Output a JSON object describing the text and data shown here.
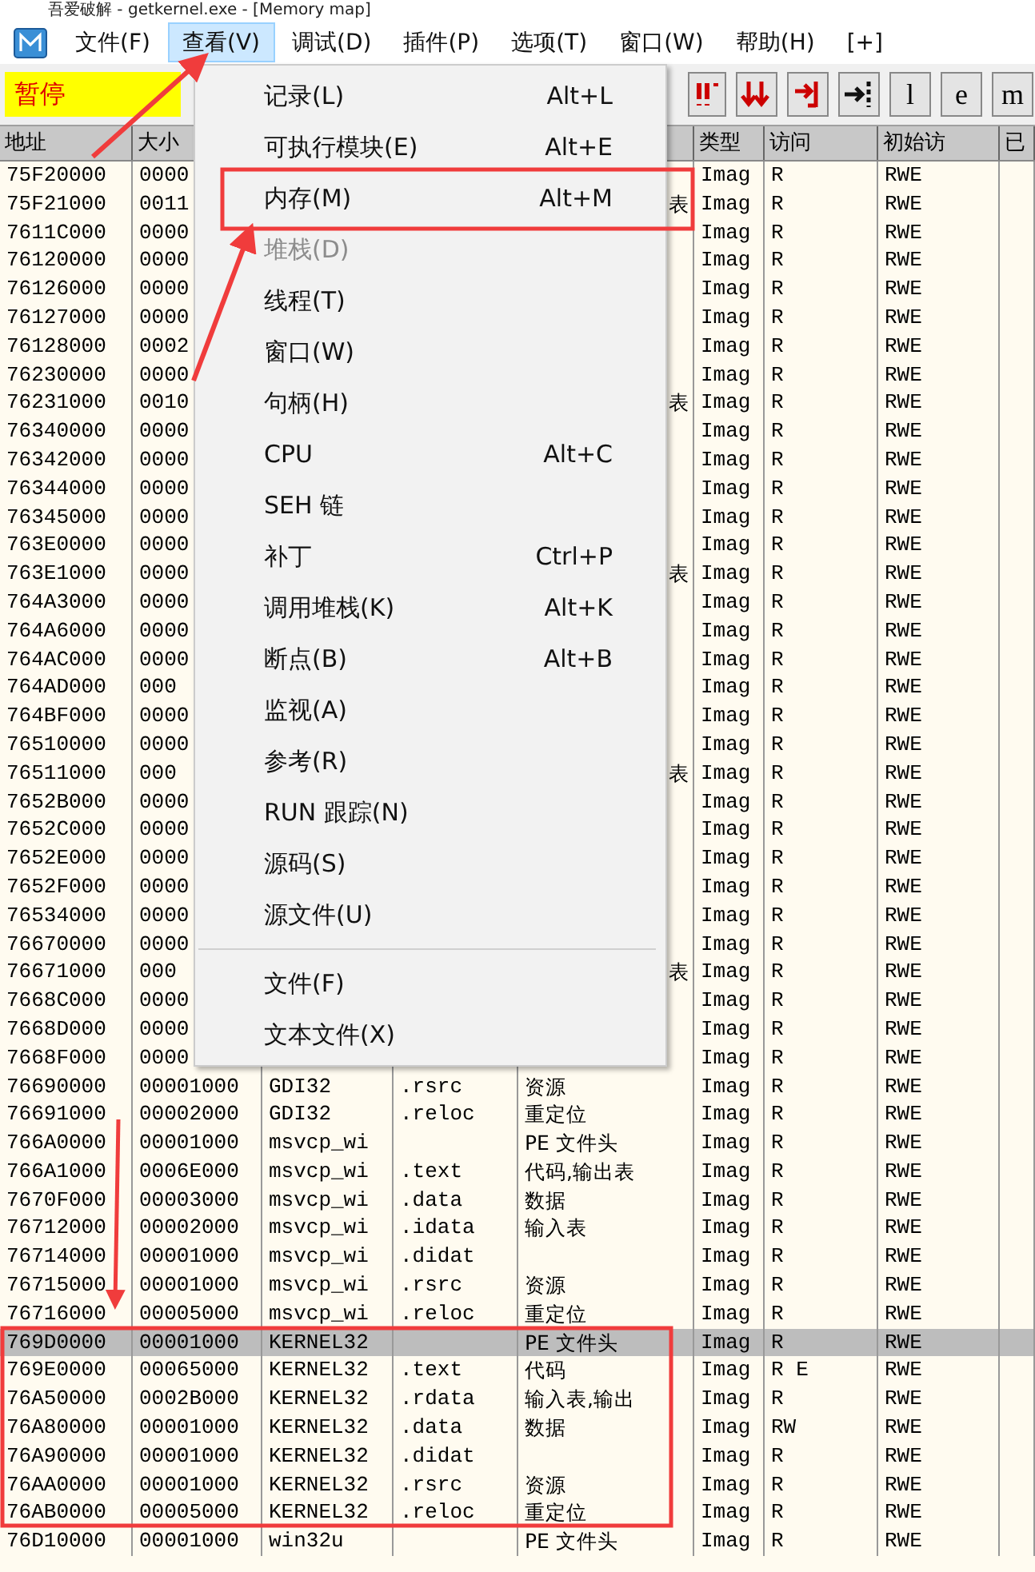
{
  "window": {
    "title": "吾爱破解 - getkernel.exe - [Memory map]"
  },
  "menu_bar": [
    {
      "label": "文件(F)",
      "selected": false
    },
    {
      "label": "查看(V)",
      "selected": true
    },
    {
      "label": "调试(D)",
      "selected": false
    },
    {
      "label": "插件(P)",
      "selected": false
    },
    {
      "label": "选项(T)",
      "selected": false
    },
    {
      "label": "窗口(W)",
      "selected": false
    },
    {
      "label": "帮助(H)",
      "selected": false
    },
    {
      "label": "[+]",
      "selected": false
    }
  ],
  "toolbar": {
    "status": "暂停",
    "letter_buttons": [
      "l",
      "e",
      "m"
    ]
  },
  "dropdown": {
    "items": [
      {
        "kind": "item",
        "label": "记录(L)",
        "shortcut": "Alt+L",
        "disabled": false
      },
      {
        "kind": "item",
        "label": "可执行模块(E)",
        "shortcut": "Alt+E",
        "disabled": false
      },
      {
        "kind": "item",
        "label": "内存(M)",
        "shortcut": "Alt+M",
        "disabled": false
      },
      {
        "kind": "item",
        "label": "堆栈(D)",
        "disabled": true
      },
      {
        "kind": "item",
        "label": "线程(T)",
        "disabled": false
      },
      {
        "kind": "item",
        "label": "窗口(W)",
        "disabled": false
      },
      {
        "kind": "item",
        "label": "句柄(H)",
        "disabled": false
      },
      {
        "kind": "item",
        "label": "CPU",
        "shortcut": "Alt+C",
        "disabled": false
      },
      {
        "kind": "item",
        "label": "SEH 链",
        "disabled": false
      },
      {
        "kind": "item",
        "label": "补丁",
        "shortcut": "Ctrl+P",
        "disabled": false
      },
      {
        "kind": "item",
        "label": "调用堆栈(K)",
        "shortcut": "Alt+K",
        "disabled": false
      },
      {
        "kind": "item",
        "label": "断点(B)",
        "shortcut": "Alt+B",
        "disabled": false
      },
      {
        "kind": "item",
        "label": "监视(A)",
        "disabled": false
      },
      {
        "kind": "item",
        "label": "参考(R)",
        "disabled": false
      },
      {
        "kind": "item",
        "label": "RUN 跟踪(N)",
        "disabled": false
      },
      {
        "kind": "item",
        "label": "源码(S)",
        "disabled": false
      },
      {
        "kind": "item",
        "label": "源文件(U)",
        "disabled": false
      },
      {
        "kind": "separator"
      },
      {
        "kind": "item",
        "label": "文件(F)",
        "disabled": false
      },
      {
        "kind": "item",
        "label": "文本文件(X)",
        "disabled": false
      }
    ]
  },
  "table": {
    "columns": [
      "地址",
      "大小",
      "类型",
      "访问",
      "初始访",
      "已"
    ],
    "rows": [
      {
        "selected": false,
        "address": "75F20000",
        "size": "0000",
        "type": "Imag",
        "access": "R",
        "initial_access": "RWE"
      },
      {
        "selected": false,
        "address": "75F21000",
        "size": "0011",
        "contains": "表",
        "type": "Imag",
        "access": "R",
        "initial_access": "RWE"
      },
      {
        "selected": false,
        "address": "7611C000",
        "size": "0000",
        "type": "Imag",
        "access": "R",
        "initial_access": "RWE"
      },
      {
        "selected": false,
        "address": "76120000",
        "size": "0000",
        "type": "Imag",
        "access": "R",
        "initial_access": "RWE"
      },
      {
        "selected": false,
        "address": "76126000",
        "size": "0000",
        "type": "Imag",
        "access": "R",
        "initial_access": "RWE"
      },
      {
        "selected": false,
        "address": "76127000",
        "size": "0000",
        "type": "Imag",
        "access": "R",
        "initial_access": "RWE"
      },
      {
        "selected": false,
        "address": "76128000",
        "size": "0002",
        "type": "Imag",
        "access": "R",
        "initial_access": "RWE"
      },
      {
        "selected": false,
        "address": "76230000",
        "size": "0000",
        "type": "Imag",
        "access": "R",
        "initial_access": "RWE"
      },
      {
        "selected": false,
        "address": "76231000",
        "size": "0010",
        "contains": "表",
        "type": "Imag",
        "access": "R",
        "initial_access": "RWE"
      },
      {
        "selected": false,
        "address": "76340000",
        "size": "0000",
        "type": "Imag",
        "access": "R",
        "initial_access": "RWE"
      },
      {
        "selected": false,
        "address": "76342000",
        "size": "0000",
        "type": "Imag",
        "access": "R",
        "initial_access": "RWE"
      },
      {
        "selected": false,
        "address": "76344000",
        "size": "0000",
        "type": "Imag",
        "access": "R",
        "initial_access": "RWE"
      },
      {
        "selected": false,
        "address": "76345000",
        "size": "0000",
        "type": "Imag",
        "access": "R",
        "initial_access": "RWE"
      },
      {
        "selected": false,
        "address": "763E0000",
        "size": "0000",
        "type": "Imag",
        "access": "R",
        "initial_access": "RWE"
      },
      {
        "selected": false,
        "address": "763E1000",
        "size": "0000",
        "contains": "表",
        "type": "Imag",
        "access": "R",
        "initial_access": "RWE"
      },
      {
        "selected": false,
        "address": "764A3000",
        "size": "0000",
        "type": "Imag",
        "access": "R",
        "initial_access": "RWE"
      },
      {
        "selected": false,
        "address": "764A6000",
        "size": "0000",
        "type": "Imag",
        "access": "R",
        "initial_access": "RWE"
      },
      {
        "selected": false,
        "address": "764AC000",
        "size": "0000",
        "type": "Imag",
        "access": "R",
        "initial_access": "RWE"
      },
      {
        "selected": false,
        "address": "764AD000",
        "size": "000",
        "type": "Imag",
        "access": "R",
        "initial_access": "RWE"
      },
      {
        "selected": false,
        "address": "764BF000",
        "size": "0000",
        "type": "Imag",
        "access": "R",
        "initial_access": "RWE"
      },
      {
        "selected": false,
        "address": "76510000",
        "size": "0000",
        "type": "Imag",
        "access": "R",
        "initial_access": "RWE"
      },
      {
        "selected": false,
        "address": "76511000",
        "size": "000",
        "contains": "表",
        "type": "Imag",
        "access": "R",
        "initial_access": "RWE"
      },
      {
        "selected": false,
        "address": "7652B000",
        "size": "0000",
        "type": "Imag",
        "access": "R",
        "initial_access": "RWE"
      },
      {
        "selected": false,
        "address": "7652C000",
        "size": "0000",
        "type": "Imag",
        "access": "R",
        "initial_access": "RWE"
      },
      {
        "selected": false,
        "address": "7652E000",
        "size": "0000",
        "type": "Imag",
        "access": "R",
        "initial_access": "RWE"
      },
      {
        "selected": false,
        "address": "7652F000",
        "size": "0000",
        "type": "Imag",
        "access": "R",
        "initial_access": "RWE"
      },
      {
        "selected": false,
        "address": "76534000",
        "size": "0000",
        "type": "Imag",
        "access": "R",
        "initial_access": "RWE"
      },
      {
        "selected": false,
        "address": "76670000",
        "size": "0000",
        "type": "Imag",
        "access": "R",
        "initial_access": "RWE"
      },
      {
        "selected": false,
        "address": "76671000",
        "size": "000",
        "contains": "表",
        "type": "Imag",
        "access": "R",
        "initial_access": "RWE"
      },
      {
        "selected": false,
        "address": "7668C000",
        "size": "0000",
        "type": "Imag",
        "access": "R",
        "initial_access": "RWE"
      },
      {
        "selected": false,
        "address": "7668D000",
        "size": "0000",
        "type": "Imag",
        "access": "R",
        "initial_access": "RWE"
      },
      {
        "selected": false,
        "address": "7668F000",
        "size": "0000",
        "type": "Imag",
        "access": "R",
        "initial_access": "RWE"
      },
      {
        "selected": false,
        "address": "76690000",
        "size": "00001000",
        "owner": "GDI32",
        "section": ".rsrc",
        "contains": "资源",
        "type": "Imag",
        "access": "R",
        "initial_access": "RWE"
      },
      {
        "selected": false,
        "address": "76691000",
        "size": "00002000",
        "owner": "GDI32",
        "section": ".reloc",
        "contains": "重定位",
        "type": "Imag",
        "access": "R",
        "initial_access": "RWE"
      },
      {
        "selected": false,
        "address": "766A0000",
        "size": "00001000",
        "owner": "msvcp_wi",
        "contains": "PE 文件头",
        "type": "Imag",
        "access": "R",
        "initial_access": "RWE"
      },
      {
        "selected": false,
        "address": "766A1000",
        "size": "0006E000",
        "owner": "msvcp_wi",
        "section": ".text",
        "contains": "代码,输出表",
        "type": "Imag",
        "access": "R",
        "initial_access": "RWE"
      },
      {
        "selected": false,
        "address": "7670F000",
        "size": "00003000",
        "owner": "msvcp_wi",
        "section": ".data",
        "contains": "数据",
        "type": "Imag",
        "access": "R",
        "initial_access": "RWE"
      },
      {
        "selected": false,
        "address": "76712000",
        "size": "00002000",
        "owner": "msvcp_wi",
        "section": ".idata",
        "contains": "输入表",
        "type": "Imag",
        "access": "R",
        "initial_access": "RWE"
      },
      {
        "selected": false,
        "address": "76714000",
        "size": "00001000",
        "owner": "msvcp_wi",
        "section": ".didat",
        "type": "Imag",
        "access": "R",
        "initial_access": "RWE"
      },
      {
        "selected": false,
        "address": "76715000",
        "size": "00001000",
        "owner": "msvcp_wi",
        "section": ".rsrc",
        "contains": "资源",
        "type": "Imag",
        "access": "R",
        "initial_access": "RWE"
      },
      {
        "selected": false,
        "address": "76716000",
        "size": "00005000",
        "owner": "msvcp_wi",
        "section": ".reloc",
        "contains": "重定位",
        "type": "Imag",
        "access": "R",
        "initial_access": "RWE"
      },
      {
        "selected": true,
        "address": "769D0000",
        "size": "00001000",
        "owner": "KERNEL32",
        "contains": "PE 文件头",
        "type": "Imag",
        "access": "R",
        "initial_access": "RWE"
      },
      {
        "selected": false,
        "address": "769E0000",
        "size": "00065000",
        "owner": "KERNEL32",
        "section": ".text",
        "contains": "代码",
        "type": "Imag",
        "access": "R E",
        "initial_access": "RWE"
      },
      {
        "selected": false,
        "address": "76A50000",
        "size": "0002B000",
        "owner": "KERNEL32",
        "section": ".rdata",
        "contains": "输入表,输出",
        "type": "Imag",
        "access": "R",
        "initial_access": "RWE"
      },
      {
        "selected": false,
        "address": "76A80000",
        "size": "00001000",
        "owner": "KERNEL32",
        "section": ".data",
        "contains": "数据",
        "type": "Imag",
        "access": "RW",
        "initial_access": "RWE"
      },
      {
        "selected": false,
        "address": "76A90000",
        "size": "00001000",
        "owner": "KERNEL32",
        "section": ".didat",
        "type": "Imag",
        "access": "R",
        "initial_access": "RWE"
      },
      {
        "selected": false,
        "address": "76AA0000",
        "size": "00001000",
        "owner": "KERNEL32",
        "section": ".rsrc",
        "contains": "资源",
        "type": "Imag",
        "access": "R",
        "initial_access": "RWE"
      },
      {
        "selected": false,
        "address": "76AB0000",
        "size": "00005000",
        "owner": "KERNEL32",
        "section": ".reloc",
        "contains": "重定位",
        "type": "Imag",
        "access": "R",
        "initial_access": "RWE"
      },
      {
        "selected": false,
        "address": "76D10000",
        "size": "00001000",
        "owner": "win32u",
        "contains": "PE 文件头",
        "type": "Imag",
        "access": "R",
        "initial_access": "RWE"
      }
    ]
  }
}
